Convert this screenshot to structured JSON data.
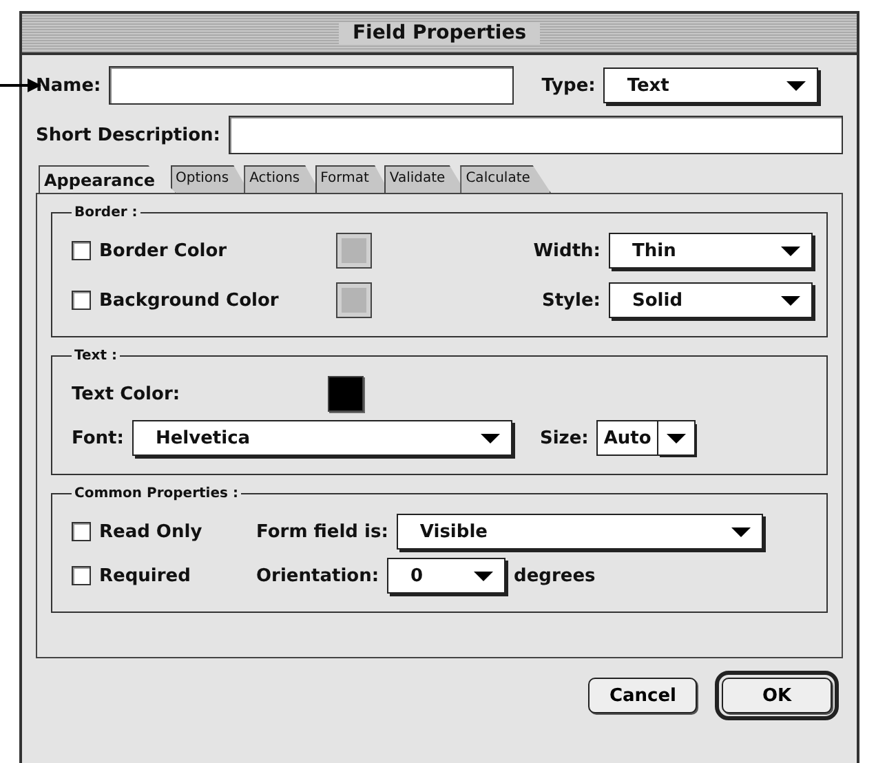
{
  "window": {
    "title": "Field Properties"
  },
  "name_field": {
    "label": "Name:"
  },
  "type_field": {
    "label": "Type:",
    "value": "Text"
  },
  "description_field": {
    "label": "Short Description:"
  },
  "tabs": [
    {
      "label": "Appearance",
      "selected": true
    },
    {
      "label": "Options",
      "selected": false
    },
    {
      "label": "Actions",
      "selected": false
    },
    {
      "label": "Format",
      "selected": false
    },
    {
      "label": "Validate",
      "selected": false
    },
    {
      "label": "Calculate",
      "selected": false
    }
  ],
  "border_group": {
    "title": "Border :",
    "checkboxes": [
      {
        "label": "Border Color",
        "checked": false
      },
      {
        "label": "Background Color",
        "checked": false
      }
    ],
    "width": {
      "label": "Width:",
      "value": "Thin"
    },
    "style": {
      "label": "Style:",
      "value": "Solid"
    }
  },
  "text_group": {
    "title": "Text :",
    "color_label": "Text Color:",
    "font": {
      "label": "Font:",
      "value": "Helvetica"
    },
    "size": {
      "label": "Size:",
      "value": "Auto"
    }
  },
  "common_group": {
    "title": "Common Properties :",
    "checkboxes": [
      {
        "label": "Read Only",
        "checked": false
      },
      {
        "label": "Required",
        "checked": false
      }
    ],
    "visibility": {
      "label": "Form field is:",
      "value": "Visible"
    },
    "orientation": {
      "label": "Orientation:",
      "value": "0",
      "unit": "degrees"
    }
  },
  "buttons": [
    {
      "label": "Cancel",
      "default": false
    },
    {
      "label": "OK",
      "default": true
    }
  ]
}
